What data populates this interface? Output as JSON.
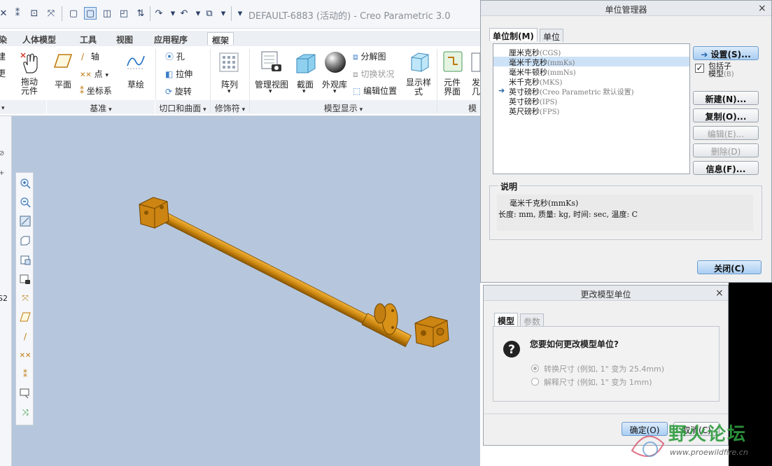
{
  "window": {
    "title": "DEFAULT-6883 (活动的) - Creo Parametric 3.0"
  },
  "ribbon": {
    "tabs": [
      "染",
      "人体模型",
      "工具",
      "视图",
      "应用程序",
      "框架"
    ],
    "tools": {
      "cut_left_top": "建",
      "cut_left_bottom": "更",
      "drag_component": "拖动\n元件",
      "plane": "平面",
      "axis": "轴",
      "point": "点",
      "csys": "坐标系",
      "sketch": "草绘",
      "hole": "孔",
      "extrude": "拉伸",
      "revolve": "旋转",
      "pattern": "阵列",
      "manage_views": "管理视图",
      "section": "截面",
      "appearance": "外观库",
      "explode_view": "分解图",
      "toggle_status": "切换状况",
      "edit_position": "编辑位置",
      "display_style": "显示样\n式",
      "component_interface": "元件\n界面",
      "publish_geom": "发\n几"
    },
    "groups": {
      "datum": "基准",
      "cut_surface": "切口和曲面",
      "modifiers": "修饰符",
      "model_display": "模型显示",
      "model_cut": "模"
    }
  },
  "left_strip": {
    "label": "S2"
  },
  "units_manager": {
    "title": "单位管理器",
    "tabs": [
      "单位制(M)",
      "单位"
    ],
    "systems": [
      {
        "name": "厘米克秒",
        "abbr": "(CGS)"
      },
      {
        "name": "毫米千克秒",
        "abbr": "(mmKs)"
      },
      {
        "name": "毫米牛顿秒",
        "abbr": "(mmNs)"
      },
      {
        "name": "米千克秒",
        "abbr": "(MKS)"
      },
      {
        "name": "英寸磅秒",
        "abbr": "(Creo Parametric 默认设置)"
      },
      {
        "name": "英寸磅秒",
        "abbr": "(IPS)"
      },
      {
        "name": "英尺磅秒",
        "abbr": "(FPS)"
      }
    ],
    "selected_index": 1,
    "default_index": 4,
    "buttons": {
      "set": "设置(S)...",
      "new": "新建(N)...",
      "copy": "复制(O)...",
      "edit": "编辑(E)...",
      "delete": "删除(D)",
      "info": "信息(F)...",
      "close": "关闭(C)"
    },
    "include_model_checkbox": {
      "label_line1": "包括子",
      "label_line2": "模型",
      "shortcut": "(B)",
      "checked": true
    },
    "description": {
      "legend": "说明",
      "line1": "毫米千克秒(mmKs)",
      "line2": "长度: mm, 质量: kg, 时间: sec, 温度: C"
    }
  },
  "change_units_dialog": {
    "title": "更改模型单位",
    "tabs": [
      "模型",
      "参数"
    ],
    "question": "您要如何更改模型单位?",
    "options": [
      {
        "label": "转换尺寸 (例如, 1\" 变为 25.4mm)",
        "selected": true
      },
      {
        "label": "解释尺寸 (例如, 1\" 变为 1mm)",
        "selected": false
      }
    ],
    "buttons": {
      "ok": "确定(O)",
      "cancel": "取消(C)"
    }
  },
  "watermark": {
    "text": "野火论坛",
    "url": "www.proewildfire.cn"
  },
  "colors": {
    "viewport": "#b6c7dd",
    "part": "#c9840e",
    "selection": "#cde2f7"
  }
}
